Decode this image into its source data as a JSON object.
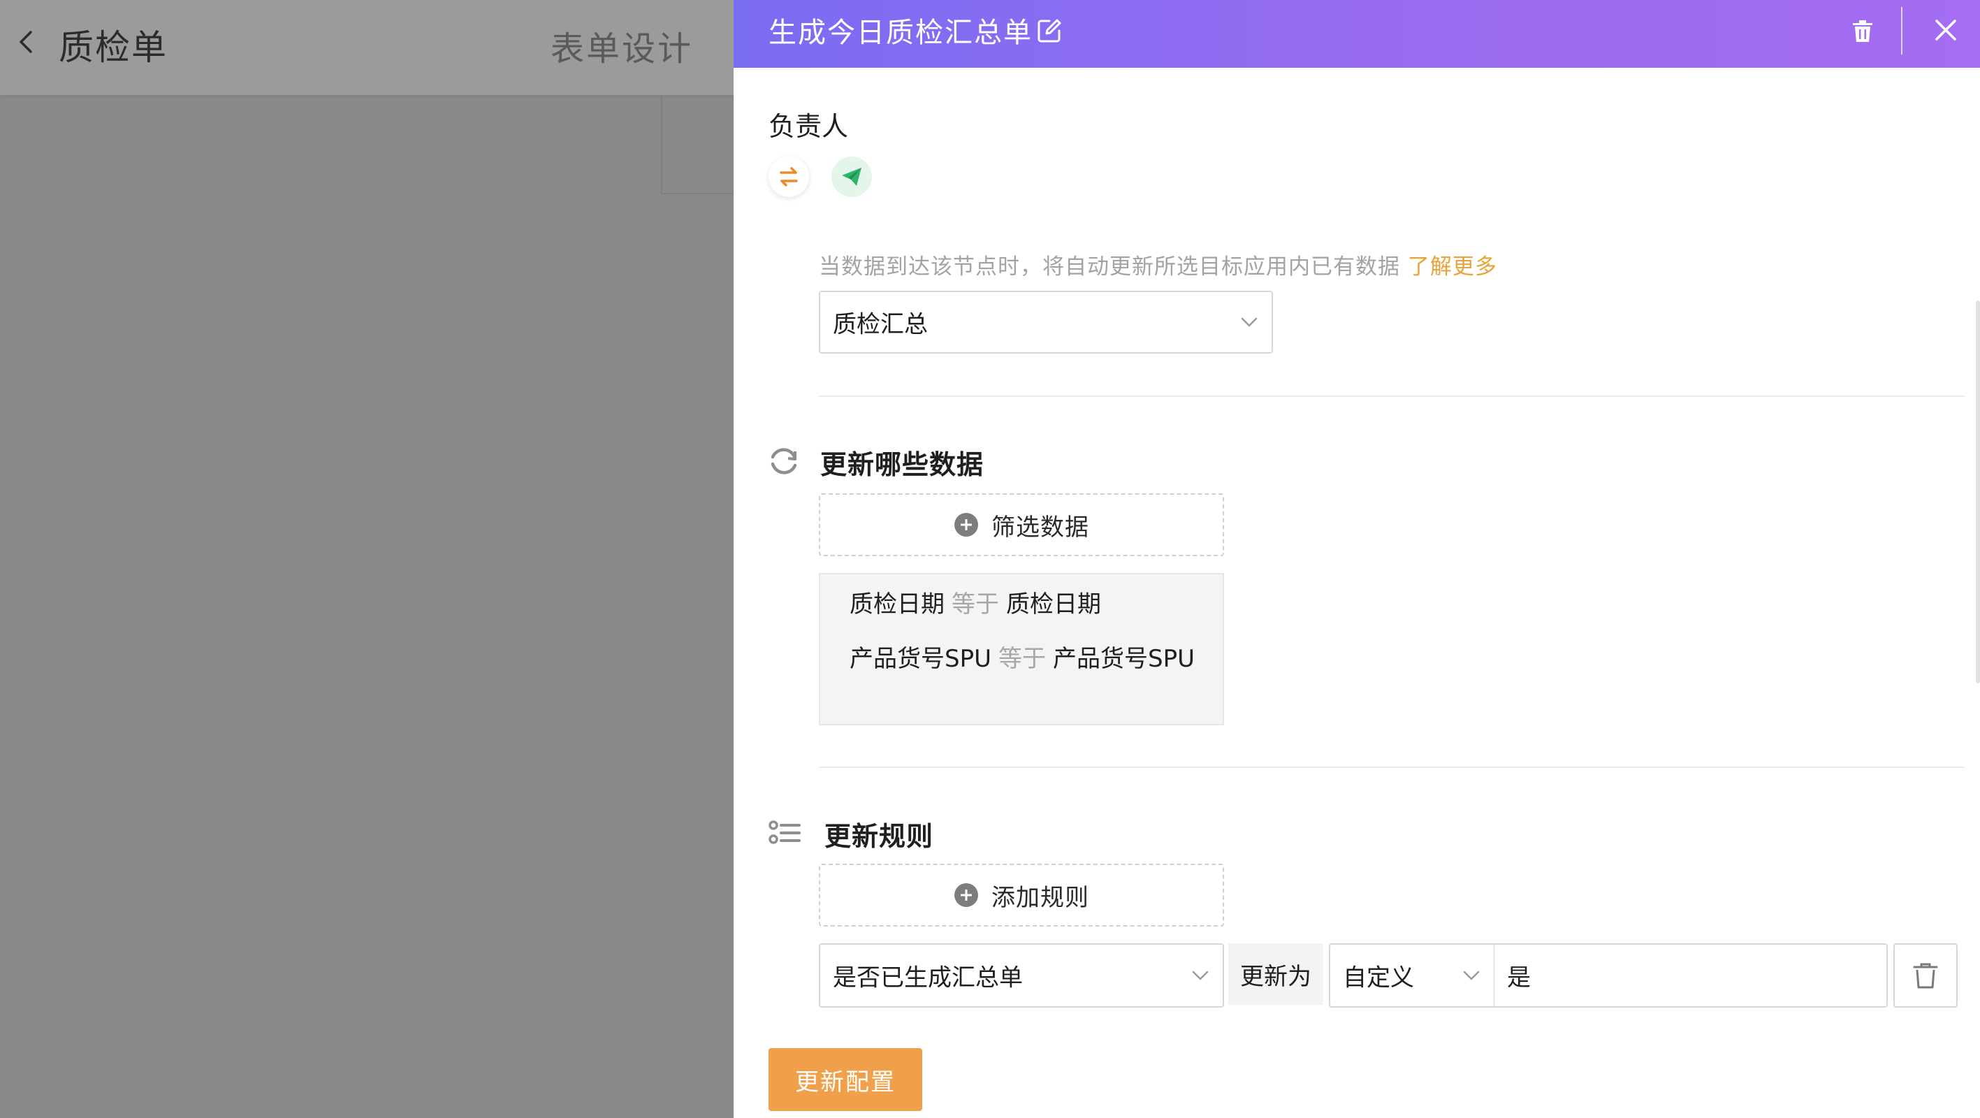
{
  "background": {
    "title": "质检单",
    "tab": "表单设计"
  },
  "drawer": {
    "title": "生成今日质检汇总单",
    "owner_label": "负责人",
    "hint_text": "当数据到达该节点时，将自动更新所选目标应用内已有数据",
    "hint_link": "了解更多",
    "target_app": "质检汇总",
    "section_update_data": {
      "title": "更新哪些数据",
      "filter_button": "筛选数据",
      "conditions": [
        {
          "field": "质检日期",
          "op": "等于",
          "value": "质检日期"
        },
        {
          "field": "产品货号SPU",
          "op": "等于",
          "value": "产品货号SPU"
        }
      ]
    },
    "section_update_rules": {
      "title": "更新规则",
      "add_button": "添加规则",
      "rule": {
        "field": "是否已生成汇总单",
        "update_as": "更新为",
        "type": "自定义",
        "value": "是"
      }
    },
    "primary_button": "更新配置"
  },
  "colors": {
    "header_gradient_start": "#7a6cf2",
    "header_gradient_end": "#a46df2",
    "link": "#e8a33a",
    "primary": "#f0a04a"
  }
}
